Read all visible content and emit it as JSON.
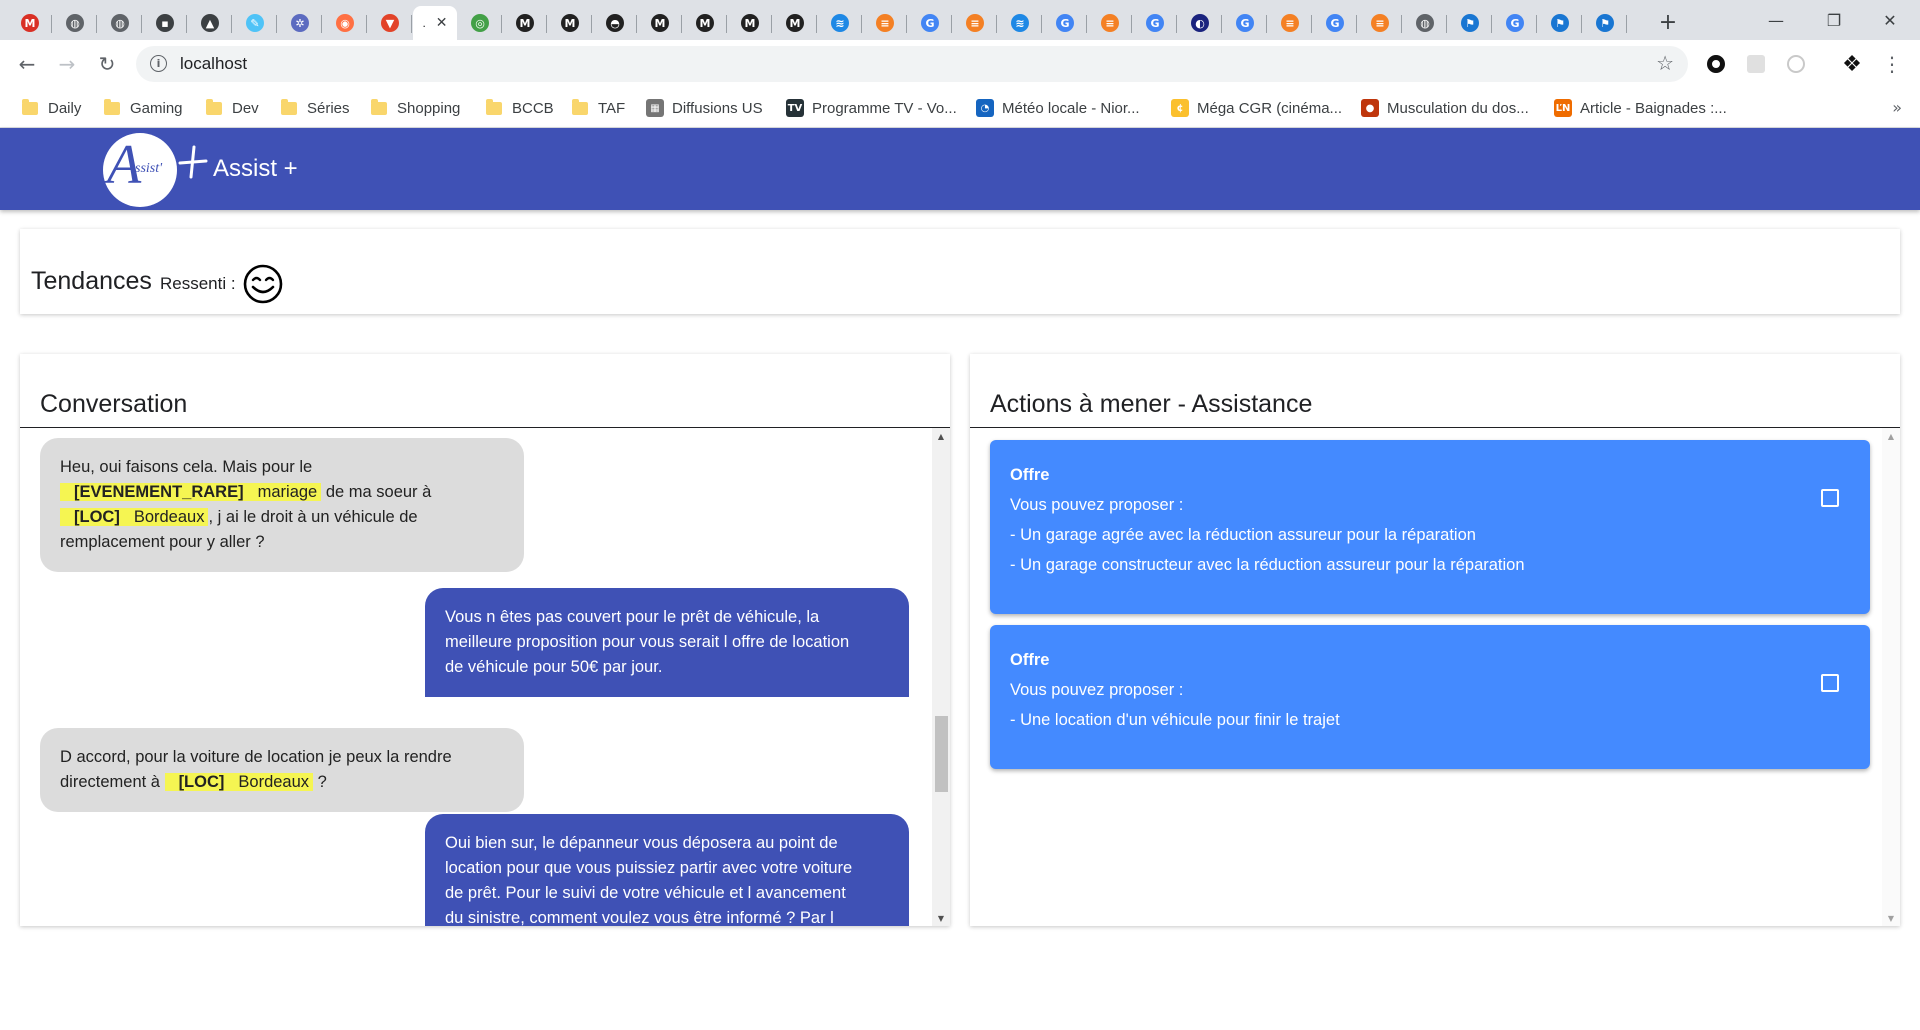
{
  "browser": {
    "url": "localhost",
    "active_tab_label": ".",
    "tabs": [
      {
        "icon": "gmail-icon",
        "color": "#d93025",
        "glyph": "M"
      },
      {
        "icon": "globe-icon",
        "color": "#5f6368",
        "glyph": "◍"
      },
      {
        "icon": "globe-icon",
        "color": "#5f6368",
        "glyph": "◍"
      },
      {
        "icon": "page-icon",
        "color": "#3c4043",
        "glyph": "▪"
      },
      {
        "icon": "image-icon",
        "color": "#3c4043",
        "glyph": "▲"
      },
      {
        "icon": "tool-icon",
        "color": "#4fc3f7",
        "glyph": "✎"
      },
      {
        "icon": "gear-icon",
        "color": "#5c6bc0",
        "glyph": "✲"
      },
      {
        "icon": "extension-icon",
        "color": "#ff7043",
        "glyph": "◉"
      },
      {
        "icon": "gitlab-icon",
        "color": "#e24329",
        "glyph": "▼"
      },
      {
        "icon": "active-tab",
        "color": "#ffffff",
        "glyph": ""
      },
      {
        "icon": "green-icon",
        "color": "#43a047",
        "glyph": "◎"
      },
      {
        "icon": "m-icon",
        "color": "#212121",
        "glyph": "M"
      },
      {
        "icon": "m-icon",
        "color": "#212121",
        "glyph": "M"
      },
      {
        "icon": "github-icon",
        "color": "#212121",
        "glyph": "◓"
      },
      {
        "icon": "m-icon",
        "color": "#212121",
        "glyph": "M"
      },
      {
        "icon": "m-icon",
        "color": "#212121",
        "glyph": "M"
      },
      {
        "icon": "m-icon",
        "color": "#212121",
        "glyph": "M"
      },
      {
        "icon": "m-icon",
        "color": "#212121",
        "glyph": "M"
      },
      {
        "icon": "wave-icon",
        "color": "#1e88e5",
        "glyph": "≋"
      },
      {
        "icon": "stack-icon",
        "color": "#f48024",
        "glyph": "≡"
      },
      {
        "icon": "google-icon",
        "color": "#4285f4",
        "glyph": "G"
      },
      {
        "icon": "stack-icon",
        "color": "#f48024",
        "glyph": "≡"
      },
      {
        "icon": "wave-icon",
        "color": "#1e88e5",
        "glyph": "≋"
      },
      {
        "icon": "google-icon",
        "color": "#4285f4",
        "glyph": "G"
      },
      {
        "icon": "stack-icon",
        "color": "#f48024",
        "glyph": "≡"
      },
      {
        "icon": "google-icon",
        "color": "#4285f4",
        "glyph": "G"
      },
      {
        "icon": "swirl-icon",
        "color": "#1a237e",
        "glyph": "◐"
      },
      {
        "icon": "google-icon",
        "color": "#4285f4",
        "glyph": "G"
      },
      {
        "icon": "stack-icon",
        "color": "#f48024",
        "glyph": "≡"
      },
      {
        "icon": "google-icon",
        "color": "#4285f4",
        "glyph": "G"
      },
      {
        "icon": "stack-icon",
        "color": "#f48024",
        "glyph": "≡"
      },
      {
        "icon": "globe-icon",
        "color": "#5f6368",
        "glyph": "◍"
      },
      {
        "icon": "flag-icon",
        "color": "#1976d2",
        "glyph": "⚑"
      },
      {
        "icon": "google-icon",
        "color": "#4285f4",
        "glyph": "G"
      },
      {
        "icon": "flag-icon",
        "color": "#1976d2",
        "glyph": "⚑"
      },
      {
        "icon": "flag-icon",
        "color": "#1976d2",
        "glyph": "⚑"
      }
    ],
    "bookmarks": [
      {
        "label": "Daily",
        "type": "folder"
      },
      {
        "label": "Gaming",
        "type": "folder"
      },
      {
        "label": "Dev",
        "type": "folder"
      },
      {
        "label": "Séries",
        "type": "folder"
      },
      {
        "label": "Shopping",
        "type": "folder"
      },
      {
        "label": "BCCB",
        "type": "folder"
      },
      {
        "label": "TAF",
        "type": "folder"
      },
      {
        "label": "Diffusions US",
        "type": "site",
        "color": "#757575",
        "glyph": "▦"
      },
      {
        "label": "Programme TV - Vo...",
        "type": "site",
        "color": "#263238",
        "glyph": "TV"
      },
      {
        "label": "Météo locale - Nior...",
        "type": "site",
        "color": "#1565c0",
        "glyph": "◔"
      },
      {
        "label": "Méga CGR (cinéma...",
        "type": "site",
        "color": "#fbc02d",
        "glyph": "¢"
      },
      {
        "label": "Musculation du dos...",
        "type": "site",
        "color": "#bf360c",
        "glyph": "●"
      },
      {
        "label": "Article - Baignades :...",
        "type": "site",
        "color": "#ef6c00",
        "glyph": "ĽN"
      }
    ]
  },
  "app": {
    "title": "Assist +",
    "logo_letter": "A",
    "logo_text": "ssist'",
    "header_color": "#3f51b5"
  },
  "trends": {
    "title": "Tendances",
    "sentiment_label": "Ressenti :",
    "sentiment_icon": "smiling-face-icon"
  },
  "conversation": {
    "title": "Conversation",
    "messages": [
      {
        "from": "client",
        "parts": [
          {
            "t": "Heu, oui faisons cela. Mais pour le"
          },
          {
            "br": true
          },
          {
            "tag": "[EVENEMENT_RARE]",
            "value": "mariage"
          },
          {
            "t": " de ma soeur à"
          },
          {
            "br": true
          },
          {
            "tag": "[LOC]",
            "value": "Bordeaux"
          },
          {
            "t": ", j ai le droit à un véhicule de"
          },
          {
            "br": true
          },
          {
            "t": "remplacement pour y aller ?"
          }
        ]
      },
      {
        "from": "agent",
        "parts": [
          {
            "t": "Vous n êtes pas couvert pour le prêt de véhicule, la"
          },
          {
            "br": true
          },
          {
            "t": "meilleure proposition pour vous serait l offre de location"
          },
          {
            "br": true
          },
          {
            "t": "de véhicule pour 50€ par jour."
          }
        ]
      },
      {
        "from": "client",
        "parts": [
          {
            "t": "D accord, pour la voiture de location je peux la rendre"
          },
          {
            "br": true
          },
          {
            "t": "directement à "
          },
          {
            "tag": "[LOC]",
            "value": "Bordeaux"
          },
          {
            "t": " ?"
          }
        ]
      },
      {
        "from": "agent",
        "parts": [
          {
            "t": "Oui bien sur, le dépanneur vous déposera au point de"
          },
          {
            "br": true
          },
          {
            "t": "location pour que vous puissiez partir avec votre voiture"
          },
          {
            "br": true
          },
          {
            "t": "de prêt. Pour le suivi de votre véhicule et l avancement"
          },
          {
            "br": true
          },
          {
            "t": "du sinistre, comment voulez vous être informé ? Par l"
          }
        ]
      }
    ]
  },
  "actions": {
    "title": "Actions à mener - Assistance",
    "offers": [
      {
        "label": "Offre",
        "intro": "Vous pouvez proposer :",
        "items": [
          "- Un garage agrée avec la réduction assureur pour la réparation",
          "- Un garage constructeur avec la réduction assureur pour la réparation"
        ],
        "checked": false
      },
      {
        "label": "Offre",
        "intro": "Vous pouvez proposer :",
        "items": [
          "- Une location d'un véhicule pour finir le trajet"
        ],
        "checked": false
      }
    ]
  }
}
